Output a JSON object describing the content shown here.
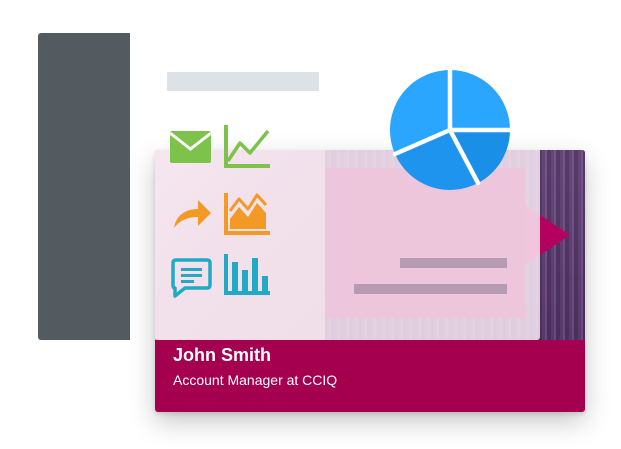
{
  "profile": {
    "name": "John Smith",
    "role": "Account Manager at CCIQ"
  },
  "icons": [
    "mail-icon",
    "line-chart-icon",
    "share-arrow-icon",
    "area-chart-icon",
    "chat-icon",
    "bar-chart-icon",
    "pie-chart-icon"
  ],
  "colors": {
    "sidebar": "#535b61",
    "card_accent": "#a5004f",
    "mail_icon": "#7dc24b",
    "line_chart_icon": "#7dc24b",
    "share_icon": "#f39a26",
    "area_chart_icon": "#f39a26",
    "chat_icon": "#21a9c6",
    "bar_chart_icon": "#21a9c6",
    "pie_chart": "#2aa6ff"
  }
}
